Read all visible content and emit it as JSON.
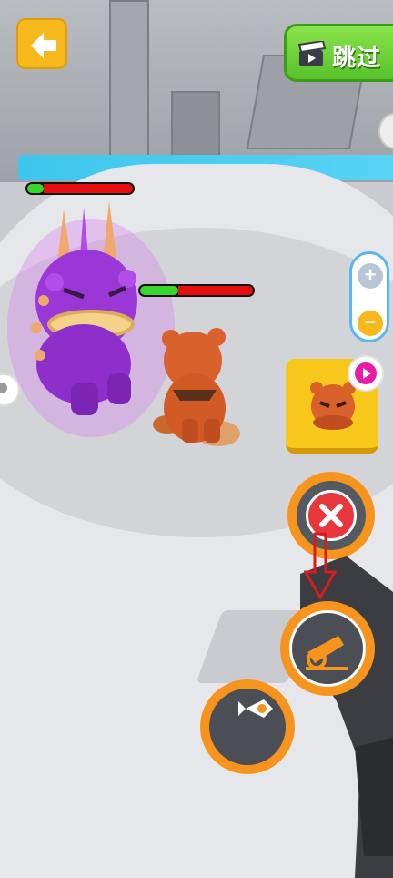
{
  "header": {
    "back_icon": "arrow-left-icon",
    "skip_label": "跳过",
    "skip_icon": "clapperboard-icon"
  },
  "health_bars": {
    "enemy_fraction": 0.15,
    "player_fraction": 0.34
  },
  "zoom": {
    "plus_icon": "plus-icon",
    "minus_icon": "minus-icon"
  },
  "actions": {
    "card_icon": "monster-portrait-icon",
    "play_icon": "play-icon",
    "cancel_icon": "close-icon",
    "cannon_icon": "cannon-icon",
    "fish_icon": "fish-icon"
  },
  "colors": {
    "accent_orange": "#f7941d",
    "skip_green": "#57c22a",
    "health_green": "#39d62d",
    "health_red": "#e50d0d",
    "cancel_red": "#e8363d",
    "zoom_blue": "#5ab7ee"
  }
}
